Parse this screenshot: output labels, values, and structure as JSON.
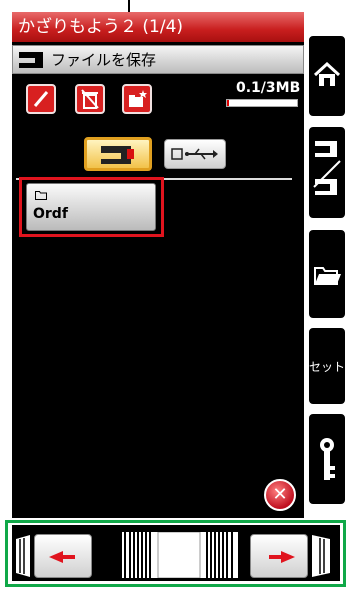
{
  "title": "かざりもよう２ (1/4)",
  "subtitle": "ファイルを保存",
  "storage": {
    "text": "0.1/3MB",
    "used_fraction": 0.03
  },
  "toolbar": [
    "rename-button",
    "delete-button",
    "new-folder-button"
  ],
  "tabs": {
    "active": "machine-memory",
    "other": "usb"
  },
  "folders": [
    {
      "name": "Ordf"
    }
  ],
  "side": {
    "set_label": "セット"
  },
  "colors": {
    "title_red": "#c81e1e",
    "accent_green": "#10a848",
    "highlight_red": "#e0141e",
    "tab_gold": "#e0a020"
  }
}
